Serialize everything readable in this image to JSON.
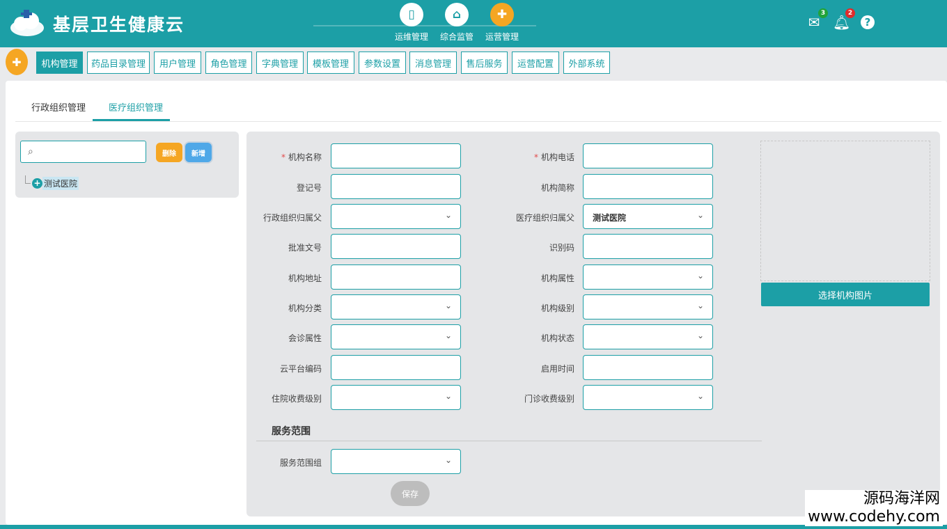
{
  "header": {
    "app_title": "基层卫生健康云",
    "modules": [
      {
        "label": "运维管理",
        "icon": "mouse-icon"
      },
      {
        "label": "综合监管",
        "icon": "home-settings-icon"
      },
      {
        "label": "运营管理",
        "icon": "calendar-plus-icon"
      }
    ],
    "mail_count": "3",
    "notification_count": "2",
    "help_symbol": "?",
    "colors": {
      "primary": "#1c9fa6",
      "orange": "#f5a623",
      "blue": "#4fa8e8"
    }
  },
  "menu": {
    "items": [
      "机构管理",
      "药品目录管理",
      "用户管理",
      "角色管理",
      "字典管理",
      "模板管理",
      "参数设置",
      "消息管理",
      "售后服务",
      "运营配置",
      "外部系统"
    ],
    "active_index": 0
  },
  "tabs": [
    "行政组织管理",
    "医疗组织管理"
  ],
  "active_tab": 1,
  "tree": {
    "search_value": "",
    "delete_label": "删除",
    "add_label": "新增",
    "nodes": [
      "测试医院"
    ]
  },
  "form": {
    "fields": {
      "name": {
        "label": "机构名称",
        "value": "",
        "required": true
      },
      "phone": {
        "label": "机构电话",
        "value": "",
        "required": true
      },
      "reg_no": {
        "label": "登记号",
        "value": ""
      },
      "short_name": {
        "label": "机构简称",
        "value": ""
      },
      "admin_parent": {
        "label": "行政组织归属父",
        "value": ""
      },
      "medical_parent": {
        "label": "医疗组织归属父",
        "value": "测试医院"
      },
      "approval_no": {
        "label": "批准文号",
        "value": ""
      },
      "id_code": {
        "label": "识别码",
        "value": ""
      },
      "address": {
        "label": "机构地址",
        "value": ""
      },
      "property": {
        "label": "机构属性",
        "value": ""
      },
      "category": {
        "label": "机构分类",
        "value": ""
      },
      "level": {
        "label": "机构级别",
        "value": ""
      },
      "consult_property": {
        "label": "会诊属性",
        "value": ""
      },
      "status": {
        "label": "机构状态",
        "value": ""
      },
      "cloud_code": {
        "label": "云平台编码",
        "value": ""
      },
      "enable_time": {
        "label": "启用时间",
        "value": ""
      },
      "inpatient_fee_level": {
        "label": "住院收费级别",
        "value": ""
      },
      "outpatient_fee_level": {
        "label": "门诊收费级别",
        "value": ""
      },
      "service_group": {
        "label": "服务范围组",
        "value": ""
      }
    },
    "required_mark": "*",
    "section_service": "服务范围",
    "save_label": "保存",
    "select_image_label": "选择机构图片"
  },
  "watermark": {
    "line1": "源码海洋网",
    "line2": "www.codehy.com"
  }
}
